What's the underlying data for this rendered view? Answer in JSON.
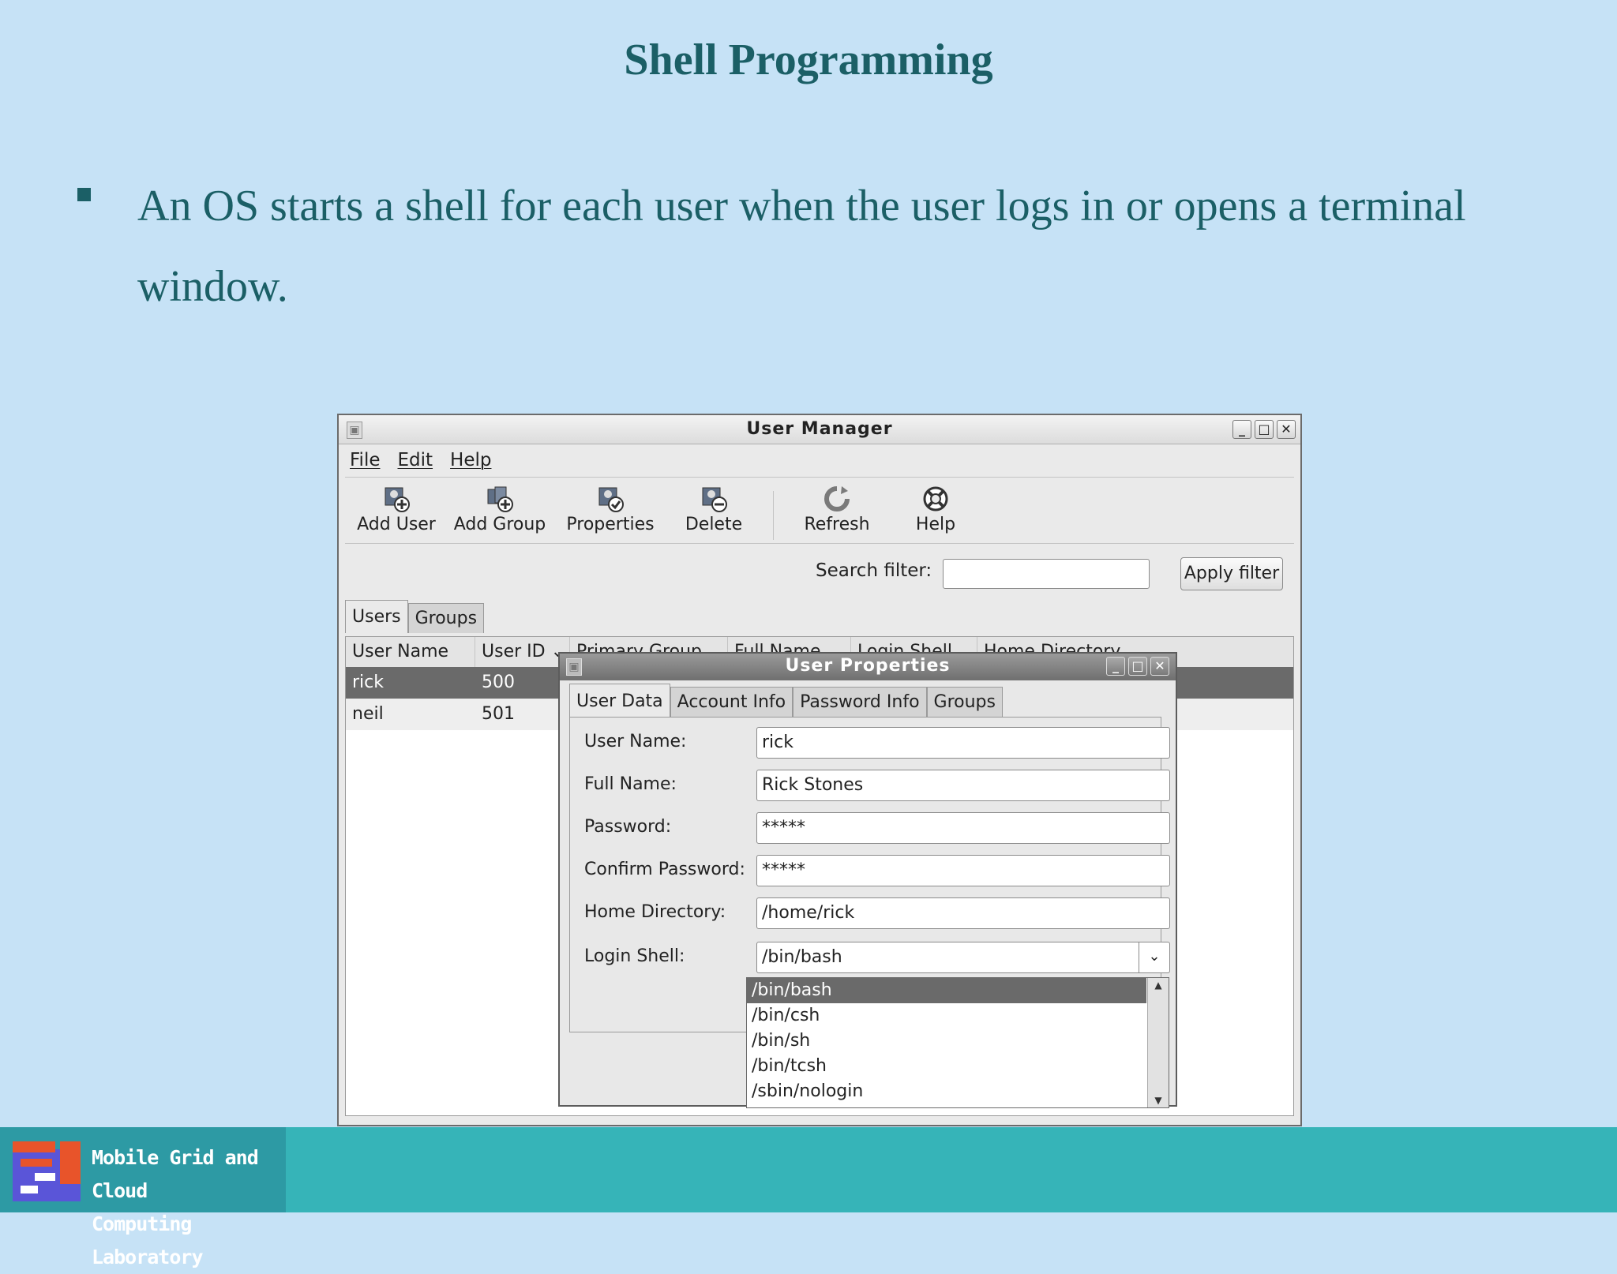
{
  "slide": {
    "title": "Shell Programming",
    "bullet": "An OS starts a shell for each user when the user logs in or opens a terminal window."
  },
  "user_manager": {
    "window_title": "User Manager",
    "menu": [
      "File",
      "Edit",
      "Help"
    ],
    "toolbar": {
      "add_user": "Add User",
      "add_group": "Add Group",
      "properties": "Properties",
      "delete": "Delete",
      "refresh": "Refresh",
      "help": "Help"
    },
    "search": {
      "label": "Search filter:",
      "value": "",
      "apply": "Apply filter"
    },
    "tabs": [
      "Users",
      "Groups"
    ],
    "columns": [
      "User Name",
      "User ID ⌄",
      "Primary Group",
      "Full Name",
      "Login Shell",
      "Home Directory"
    ],
    "rows": [
      {
        "user_name": "rick",
        "user_id": "500"
      },
      {
        "user_name": "neil",
        "user_id": "501"
      }
    ]
  },
  "user_properties": {
    "title": "User Properties",
    "tabs": [
      "User Data",
      "Account Info",
      "Password Info",
      "Groups"
    ],
    "fields": {
      "user_name_label": "User Name:",
      "user_name": "rick",
      "full_name_label": "Full Name:",
      "full_name": "Rick Stones",
      "password_label": "Password:",
      "password": "*****",
      "confirm_label": "Confirm Password:",
      "confirm": "*****",
      "home_label": "Home Directory:",
      "home": "/home/rick",
      "shell_label": "Login Shell:",
      "shell": "/bin/bash"
    },
    "shell_options": [
      "/bin/bash",
      "/bin/csh",
      "/bin/sh",
      "/bin/tcsh",
      "/sbin/nologin"
    ]
  },
  "footer": {
    "lab_line1": "Mobile Grid and Cloud",
    "lab_line2": "Computing Laboratory"
  },
  "colors": {
    "slide_bg": "#c6e2f6",
    "text": "#1b5f66",
    "footer": "#36b4b8"
  }
}
